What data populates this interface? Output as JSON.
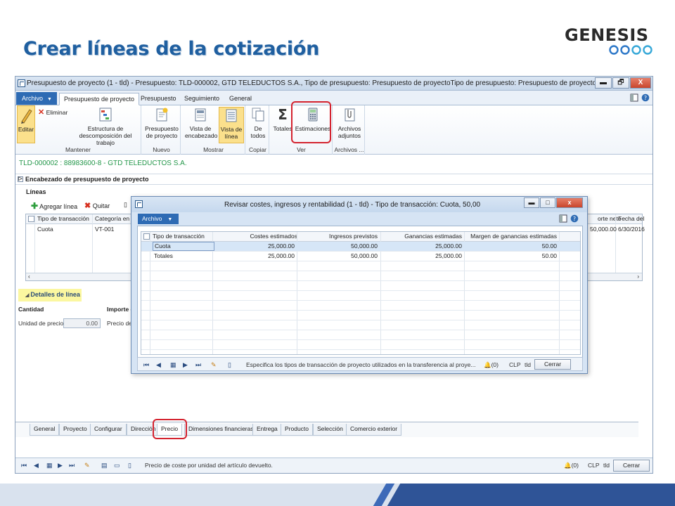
{
  "slide": {
    "title": "Crear líneas de la cotización",
    "logo_text": "GENESIS"
  },
  "window": {
    "title": "Presupuesto de proyecto (1 - tld) - Presupuesto: TLD-000002, GTD TELEDUCTOS S.A., Tipo de presupuesto: Presupuesto de proyectoTipo de presupuesto: Presupuesto de proyectoPresupu...",
    "controls": {
      "minimize": "▬",
      "restore": "🗗",
      "close": "X"
    }
  },
  "ribbon": {
    "file_tab": "Archivo",
    "tabs": [
      "Presupuesto de proyecto",
      "Presupuesto",
      "Seguimiento",
      "General"
    ],
    "groups": {
      "mantener": {
        "label": "Mantener",
        "edit": "Editar",
        "delete": "Eliminar",
        "structure": [
          "Estructura de",
          "descomposición del trabajo"
        ]
      },
      "nuevo": {
        "label": "Nuevo",
        "budget": [
          "Presupuesto",
          "de proyecto"
        ]
      },
      "mostrar": {
        "label": "Mostrar",
        "header_view": [
          "Vista de",
          "encabezado"
        ],
        "line_view": [
          "Vista de",
          "línea"
        ]
      },
      "copiar": {
        "label": "Copiar",
        "from_all": [
          "De",
          "todos"
        ]
      },
      "ver": {
        "label": "Ver",
        "totals": "Totales",
        "estimates": "Estimaciones"
      },
      "archivos": {
        "label": "Archivos ...",
        "attachments": [
          "Archivos",
          "adjuntos"
        ]
      }
    }
  },
  "record": {
    "title": "TLD-000002 : 88983600-8 - GTD TELEDUCTOS S.A.",
    "header_section": "Encabezado de presupuesto de proyecto",
    "lines_label": "Líneas",
    "toolbar": {
      "add": "Agregar línea",
      "remove": "Quitar"
    },
    "grid": {
      "columns": [
        "Tipo de transacción",
        "Categoría en p",
        "orte neto",
        "Fecha del"
      ],
      "rows": [
        {
          "type": "Cuota",
          "category": "VT-001",
          "net": "50,000.00",
          "date": "6/30/2016"
        }
      ]
    },
    "details": {
      "header": "Detalles de línea",
      "quantity_label": "Cantidad",
      "amount_label": "Importe c",
      "unit_price_label": "Unidad de precio:",
      "unit_price_value": "0.00",
      "price_label": "Precio de"
    },
    "bottom_tabs": [
      "General",
      "Proyecto",
      "Configurar",
      "Dirección",
      "Precio",
      "Dimensiones financieras",
      "Entrega",
      "Producto",
      "Selección",
      "Comercio exterior"
    ],
    "active_bottom_tab": "Precio"
  },
  "status_bar": {
    "text": "Precio de coste por unidad del artículo devuelto.",
    "alerts": "(0)",
    "currency": "CLP",
    "company": "tld",
    "close": "Cerrar"
  },
  "dialog": {
    "title": "Revisar costes, ingresos y rentabilidad (1 - tld) - Tipo de transacción: Cuota, 50,00",
    "file_tab": "Archivo",
    "columns": [
      "Tipo de transacción",
      "Costes estimados",
      "Ingresos previstos",
      "Ganancias estimadas",
      "Margen de ganancias estimadas"
    ],
    "rows": [
      {
        "type": "Cuota",
        "cost": "25,000.00",
        "revenue": "50,000.00",
        "profit": "25,000.00",
        "margin": "50.00"
      },
      {
        "type": "Totales",
        "cost": "25,000.00",
        "revenue": "50,000.00",
        "profit": "25,000.00",
        "margin": "50.00"
      }
    ],
    "status_text": "Especifica los tipos de transacción de proyecto utilizados en la transferencia al proye...",
    "alerts": "(0)",
    "currency": "CLP",
    "company": "tld",
    "close": "Cerrar"
  },
  "colors": {
    "title_blue": "#1f5fa0",
    "file_tab_blue": "#2e6bb4",
    "highlight_red": "#d4232f",
    "record_green": "#24974a",
    "highlight_yellow": "#fbf7a0"
  },
  "icons": [
    "pencil-icon",
    "delete-x-icon",
    "wbs-structure-icon",
    "new-budget-icon",
    "header-view-icon",
    "line-view-icon",
    "copy-from-all-icon",
    "sigma-totals-icon",
    "calculator-icon",
    "attachment-icon",
    "bell-icon"
  ]
}
